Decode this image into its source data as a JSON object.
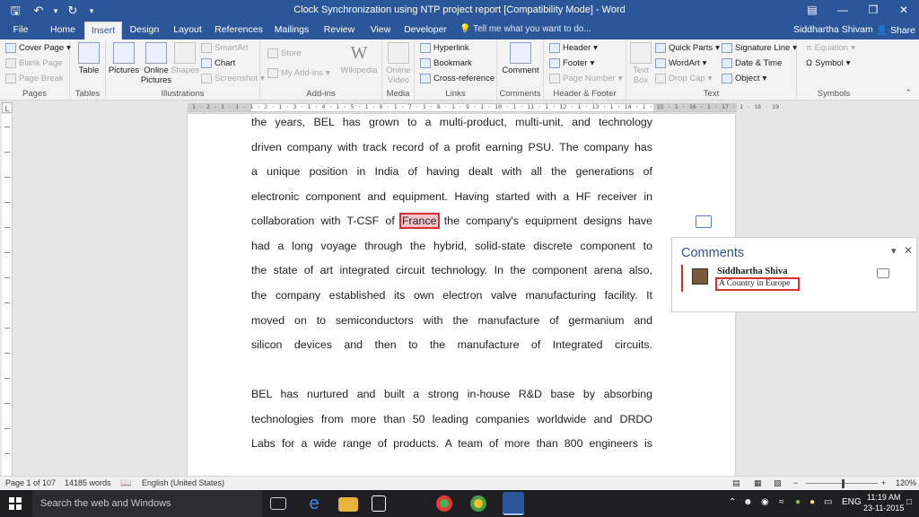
{
  "window": {
    "title": "Clock Synchronization using NTP project report [Compatibility Mode] - Word"
  },
  "tabs": [
    "File",
    "Home",
    "Insert",
    "Design",
    "Layout",
    "References",
    "Mailings",
    "Review",
    "View",
    "Developer"
  ],
  "active_tab": "Insert",
  "tell_me": "Tell me what you want to do...",
  "user": "Siddhartha Shivam",
  "share": "Share",
  "ribbon": {
    "pages": {
      "label": "Pages",
      "cover_page": "Cover Page",
      "blank_page": "Blank Page",
      "page_break": "Page Break"
    },
    "tables": {
      "label": "Tables",
      "table": "Table"
    },
    "illustrations": {
      "label": "Illustrations",
      "pictures": "Pictures",
      "online_pictures_1": "Online",
      "online_pictures_2": "Pictures",
      "shapes": "Shapes",
      "smartart": "SmartArt",
      "chart": "Chart",
      "screenshot": "Screenshot"
    },
    "addins": {
      "label": "Add-ins",
      "store": "Store",
      "my_addins": "My Add-ins",
      "wikipedia": "Wikipedia"
    },
    "media": {
      "label": "Media",
      "online_video_1": "Online",
      "online_video_2": "Video"
    },
    "links": {
      "label": "Links",
      "hyperlink": "Hyperlink",
      "bookmark": "Bookmark",
      "cross_reference": "Cross-reference"
    },
    "comments": {
      "label": "Comments",
      "comment": "Comment"
    },
    "header_footer": {
      "label": "Header & Footer",
      "header": "Header",
      "footer": "Footer",
      "page_number": "Page Number"
    },
    "text": {
      "label": "Text",
      "text_box_1": "Text",
      "text_box_2": "Box",
      "quick_parts": "Quick Parts",
      "wordart": "WordArt",
      "drop_cap": "Drop Cap",
      "signature_line": "Signature Line",
      "date_time": "Date & Time",
      "object": "Object"
    },
    "symbols": {
      "label": "Symbols",
      "equation": "Equation",
      "symbol": "Symbol"
    }
  },
  "ruler_numbers": "1 · 2 · 1 · 1 · 1 · 2 · 1 · 3 · 1 · 4 · 1 · 5 · 1 · 6 · 1 · 7 · 1 · 8 · 1 · 9 · 1 · 10 · 1 · 11 · 1 · 12 · 1 · 13 · 1 · 14 · 1 · 15 · 1 · 16 · 1 · 17 · 1 · 18 · 19",
  "document": {
    "lines": [
      "the years, BEL has grown to a multi-product, multi-unit, and technology",
      "driven company with track record of a profit earning PSU. The company has",
      "a unique position in India of having dealt with all the generations of",
      "electronic component and equipment. Having started with a HF receiver in",
      {
        "before": "collaboration with T-CSF of ",
        "highlight": "France",
        "after": " the company's equipment designs have"
      },
      "had a long voyage through the hybrid, solid-state discrete component to",
      "the state of art integrated circuit technology. In the component arena also,",
      "the company established its own electron valve manufacturing facility. It",
      "moved on to semiconductors with the manufacture of germanium and",
      "silicon devices and then to the manufacture of Integrated circuits."
    ],
    "lines2": [
      "BEL has nurtured and built a strong in-house R&D base by absorbing",
      "technologies from more than 50 leading companies worldwide and DRDO",
      "Labs for a wide range of products. A team of more than 800 engineers is"
    ]
  },
  "comments_pane": {
    "title": "Comments",
    "author": "Siddhartha Shiva",
    "text": "A Country in Europe"
  },
  "status": {
    "page": "Page 1 of 107",
    "words": "14185 words",
    "language": "English (United States)",
    "zoom": "120%"
  },
  "taskbar": {
    "search": "Search the web and Windows",
    "lang": "ENG",
    "time": "11:19 AM",
    "date": "23-11-2015"
  }
}
